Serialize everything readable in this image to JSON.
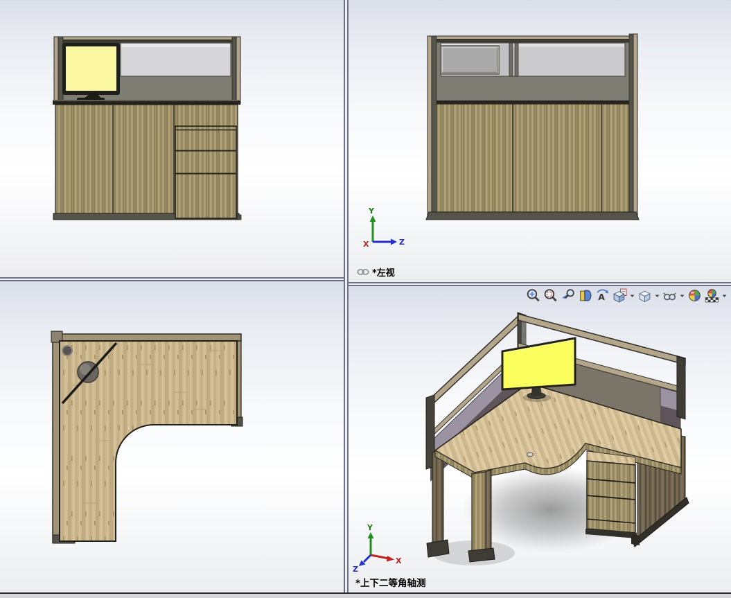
{
  "panes": {
    "top_right": {
      "label": "*左视"
    },
    "bottom_right": {
      "label": "*上下二等角轴测"
    }
  },
  "triads": {
    "side": {
      "x": "X",
      "y": "Y",
      "z": "Z"
    },
    "iso": {
      "x": "X",
      "y": "Y",
      "z": "Z"
    }
  },
  "toolbar": {
    "icons": [
      {
        "name": "zoom-to-fit",
        "dropdown": false
      },
      {
        "name": "zoom-to-area",
        "dropdown": false
      },
      {
        "name": "previous-view",
        "dropdown": false
      },
      {
        "name": "section-view",
        "dropdown": false
      },
      {
        "name": "3d-drawing-view",
        "dropdown": false
      },
      {
        "name": "view-orientation",
        "dropdown": true
      },
      {
        "name": "display-style",
        "dropdown": true
      },
      {
        "name": "hide-show-items",
        "dropdown": true
      },
      {
        "name": "edit-appearance",
        "dropdown": false
      },
      {
        "name": "apply-scene",
        "dropdown": true
      }
    ]
  },
  "palette": {
    "background_top": "#dbdfe9",
    "divider": "#6d7289",
    "monitor_screen_front": "#fbf7a0",
    "monitor_screen_iso": "#fbff5e",
    "wood_panel": "#a5986f",
    "bamboo_desktop": "#cdb88f",
    "dark_wood": "#6f6350",
    "partition_gray": "#7d7d74",
    "glass": "#d6d6d8",
    "mauve_glass": "#9b93a1",
    "plum_glass": "#5e5459",
    "rail_khaki": "#b3a68a",
    "axis_x": "#c42222",
    "axis_y": "#1f8f1f",
    "axis_z": "#2330c8"
  }
}
